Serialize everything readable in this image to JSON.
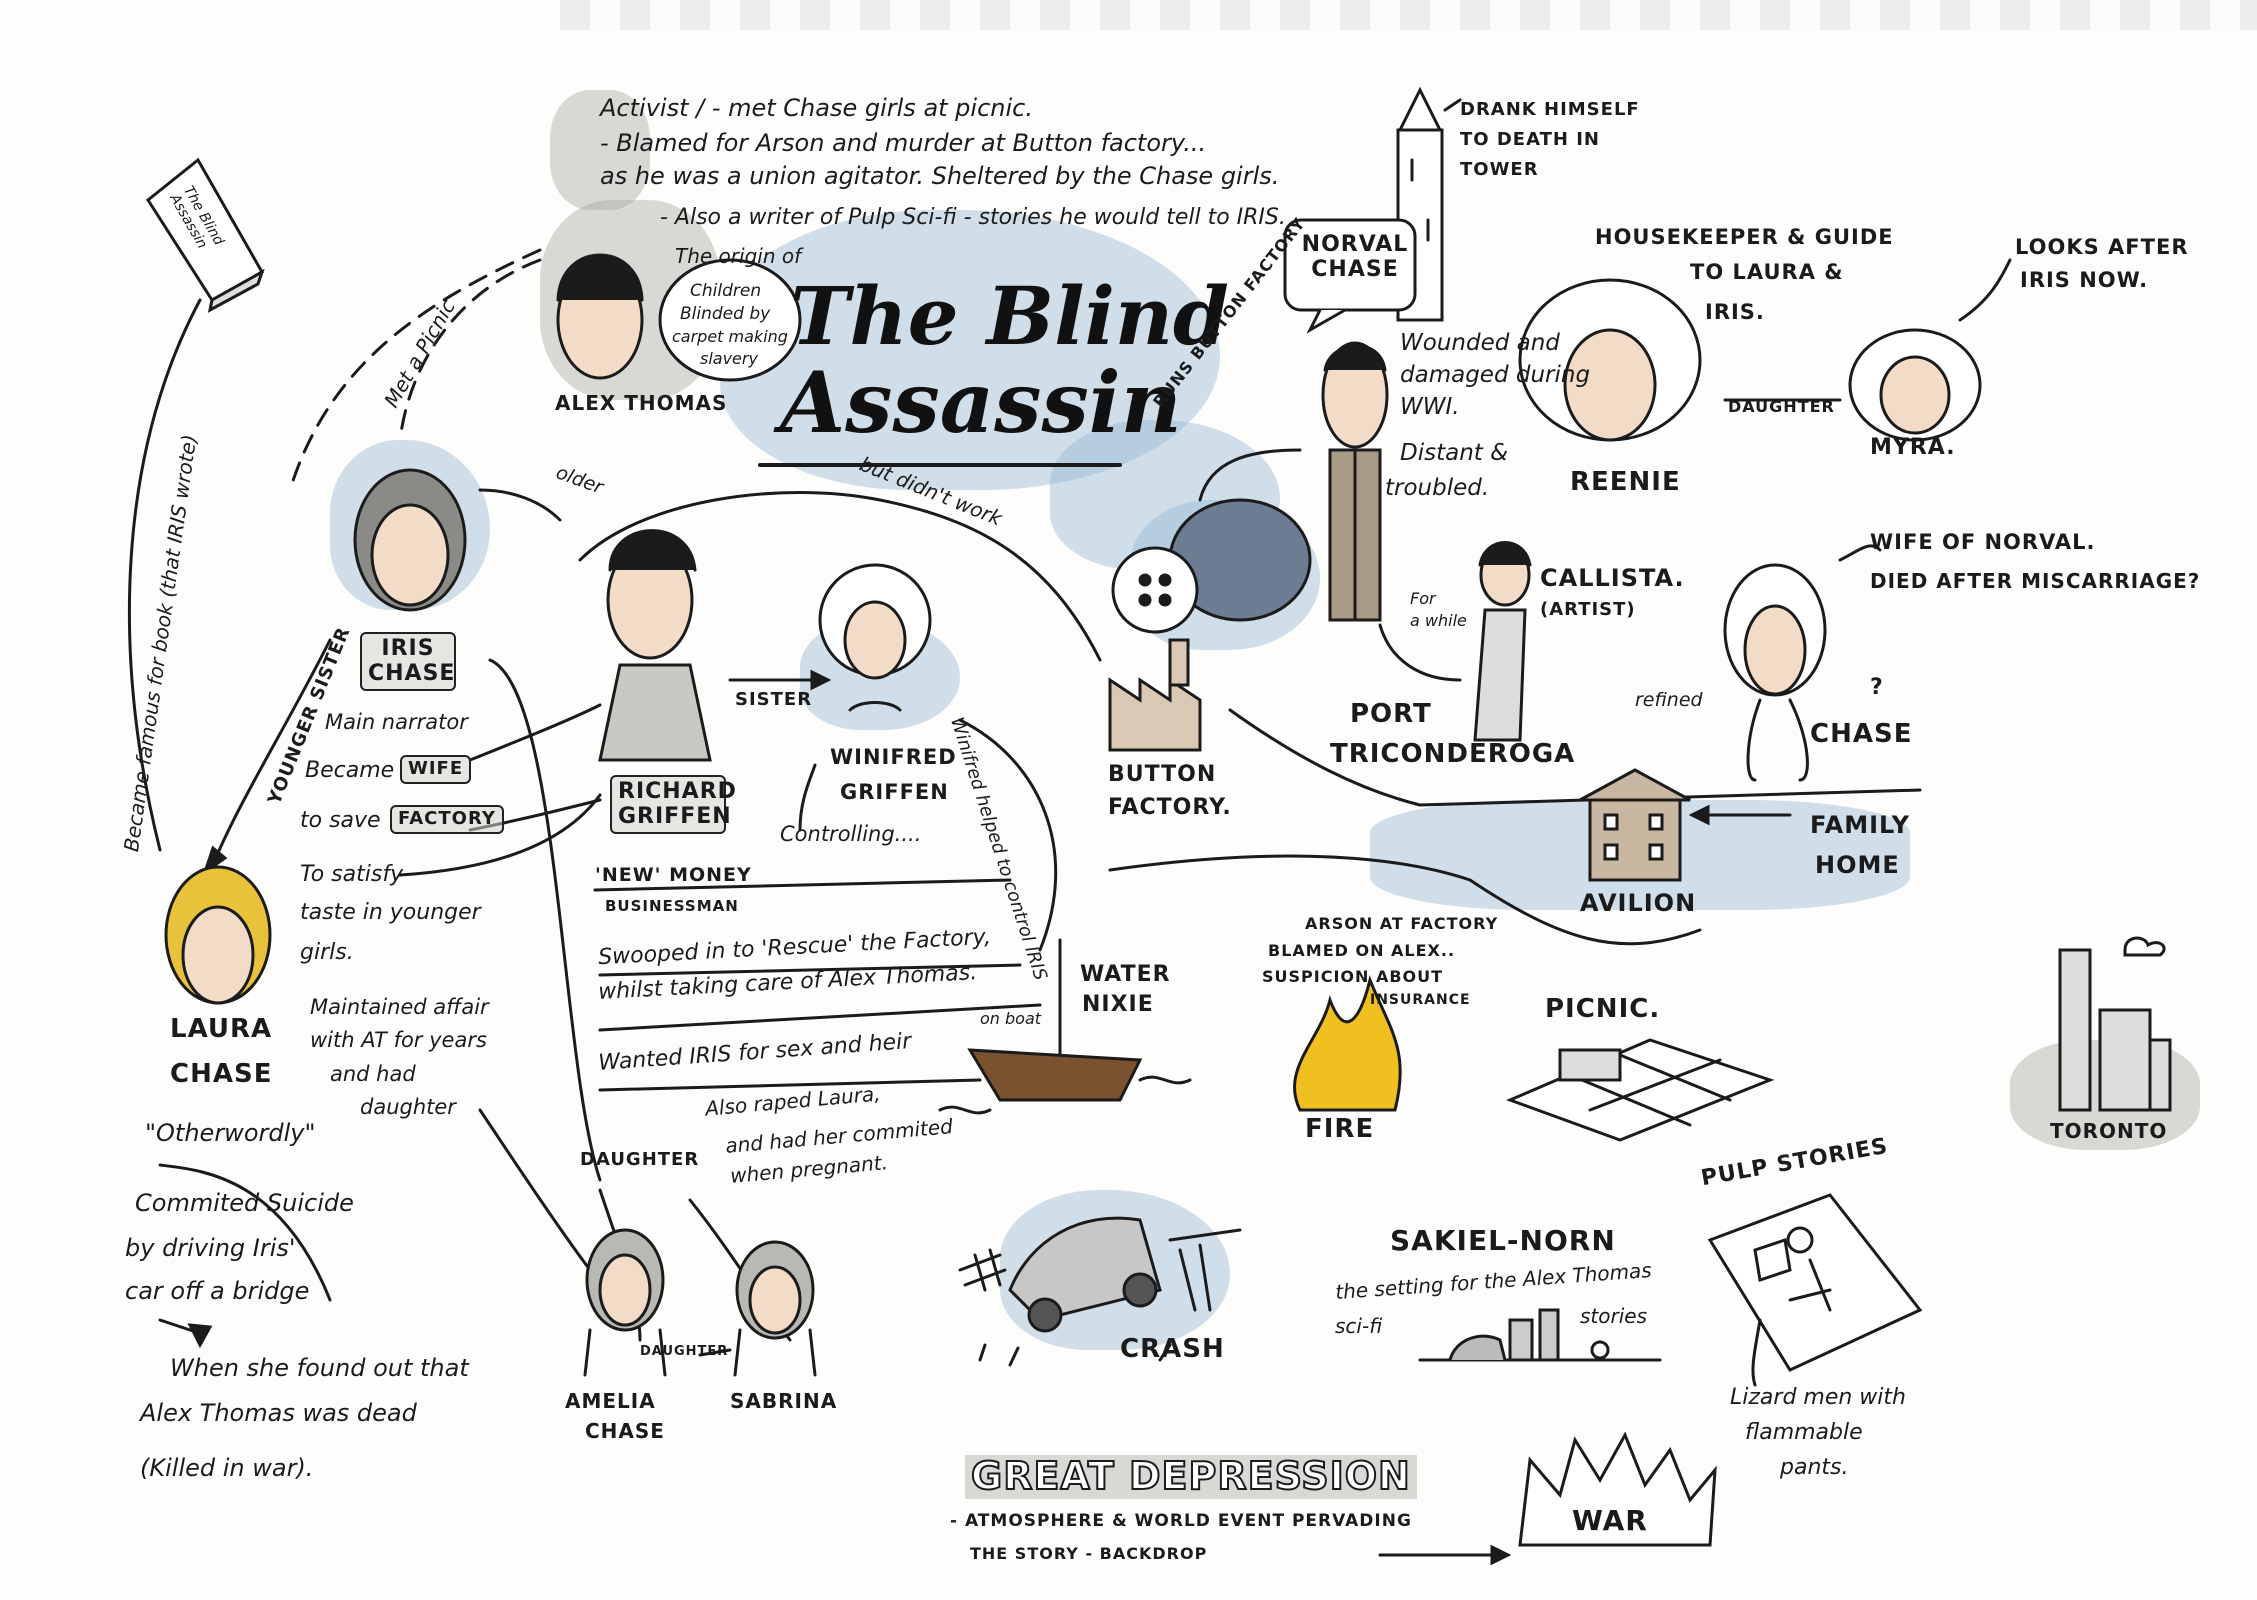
{
  "title_line1": "The Blind",
  "title_line2": "Assassin",
  "book_cover": {
    "text": "The Blind Assassin"
  },
  "alex": {
    "name": "ALEX THOMAS",
    "notes": [
      "Activist / - met Chase girls at picnic.",
      "- Blamed for Arson and murder at Button factory...",
      "as he was a union agitator. Sheltered by the Chase girls.",
      "- Also a writer of Pulp Sci-fi - stories he would tell to IRIS."
    ],
    "origin_label": "The origin of",
    "origin_bubble": [
      "Children",
      "Blinded by",
      "carpet making",
      "slavery"
    ]
  },
  "norval": {
    "name": "NORVAL CHASE",
    "tower_note": [
      "DRANK HIMSELF",
      "TO DEATH IN",
      "TOWER"
    ],
    "notes": [
      "Wounded and",
      "damaged during",
      "WWI.",
      "Distant &",
      "troubled."
    ],
    "runs": "RUNS BUTTON FACTORY"
  },
  "reenie": {
    "name": "REENIE",
    "note": [
      "HOUSEKEEPER & GUIDE",
      "TO LAURA &",
      "IRIS."
    ],
    "daughter_label": "DAUGHTER"
  },
  "myra": {
    "name": "MYRA.",
    "note": [
      "LOOKS AFTER",
      "IRIS NOW."
    ]
  },
  "callista": {
    "name": "CALLISTA.",
    "role": "(ARTIST)",
    "for_while": [
      "For",
      "a while"
    ]
  },
  "wife_norval": {
    "name": "CHASE",
    "note1": "WIFE OF NORVAL.",
    "note2": "DIED AFTER MISCARRIAGE?",
    "refined": "refined",
    "question": "?"
  },
  "iris": {
    "name": [
      "IRIS",
      "CHASE"
    ],
    "role": "Main narrator",
    "became": "Became",
    "wife": "WIFE",
    "to_save": "to save",
    "factory": "FACTORY",
    "met_picnic": "Met a Picnic",
    "older": "older",
    "famous": "Became famous for book (that IRIS wrote)"
  },
  "laura": {
    "name": [
      "LAURA",
      "CHASE"
    ],
    "younger": "YOUNGER SISTER",
    "otherworldly": "\"Otherwordly\"",
    "suicide": [
      "Commited Suicide",
      "by driving Iris'",
      "car off a bridge"
    ],
    "found_out": [
      "When she found out that",
      "Alex Thomas was dead",
      "(Killed in war)."
    ]
  },
  "richard": {
    "name": [
      "RICHARD",
      "GRIFFEN"
    ],
    "role": [
      "'NEW' MONEY",
      "BUSINESSMAN"
    ],
    "sister": "SISTER",
    "satisfy": [
      "To satisfy",
      "taste in younger",
      "girls."
    ],
    "affair": [
      "Maintained affair",
      "with AT for years",
      "and had",
      "daughter"
    ],
    "swooped": [
      "Swooped in to 'Rescue' the Factory,",
      "whilst taking care of Alex Thomas."
    ],
    "wanted": "Wanted IRIS for sex and heir",
    "raped": [
      "Also raped Laura,",
      "and had her commited",
      "when pregnant."
    ],
    "didnt_work": "but didn't work"
  },
  "winifred": {
    "name": [
      "WINIFRED",
      "GRIFFEN"
    ],
    "controlling": "Controlling....",
    "helped": "Winifred helped to control IRIS"
  },
  "button_factory": [
    "BUTTON",
    "FACTORY."
  ],
  "port": [
    "PORT",
    "TRICONDEROGA"
  ],
  "avilion": {
    "name": "AVILION",
    "family_home": [
      "FAMILY",
      "HOME"
    ]
  },
  "arson": [
    "ARSON AT FACTORY",
    "BLAMED ON ALEX..",
    "SUSPICION ABOUT",
    "INSURANCE"
  ],
  "fire": "FIRE",
  "picnic": "PICNIC.",
  "toronto": "TORONTO",
  "water_nixie": [
    "WATER",
    "NIXIE"
  ],
  "on_boat": "on boat",
  "crash": "CRASH",
  "sakiel": {
    "name": "SAKIEL-NORN",
    "note": [
      "the setting for the Alex Thomas",
      "sci-fi",
      "stories"
    ]
  },
  "pulp": {
    "title": "PULP STORIES",
    "note": [
      "Lizard men with",
      "flammable",
      "pants."
    ]
  },
  "daughter1": "DAUGHTER",
  "daughter2": "DAUGHTER",
  "amelia": [
    "AMELIA",
    "CHASE"
  ],
  "sabrina": "SABRINA",
  "great_depression": "GREAT DEPRESSION",
  "depression_note": [
    "- ATMOSPHERE & WORLD EVENT PERVADING",
    "THE STORY - BACKDROP"
  ],
  "war": "WAR",
  "colors": {
    "ink": "#1b1b1b",
    "water": "#9dbfd6",
    "skin": "#f2dcc8",
    "grey": "#b9b9b4",
    "yellow": "#e8c23a",
    "fire": "#f0c020",
    "wood": "#7a5230"
  }
}
